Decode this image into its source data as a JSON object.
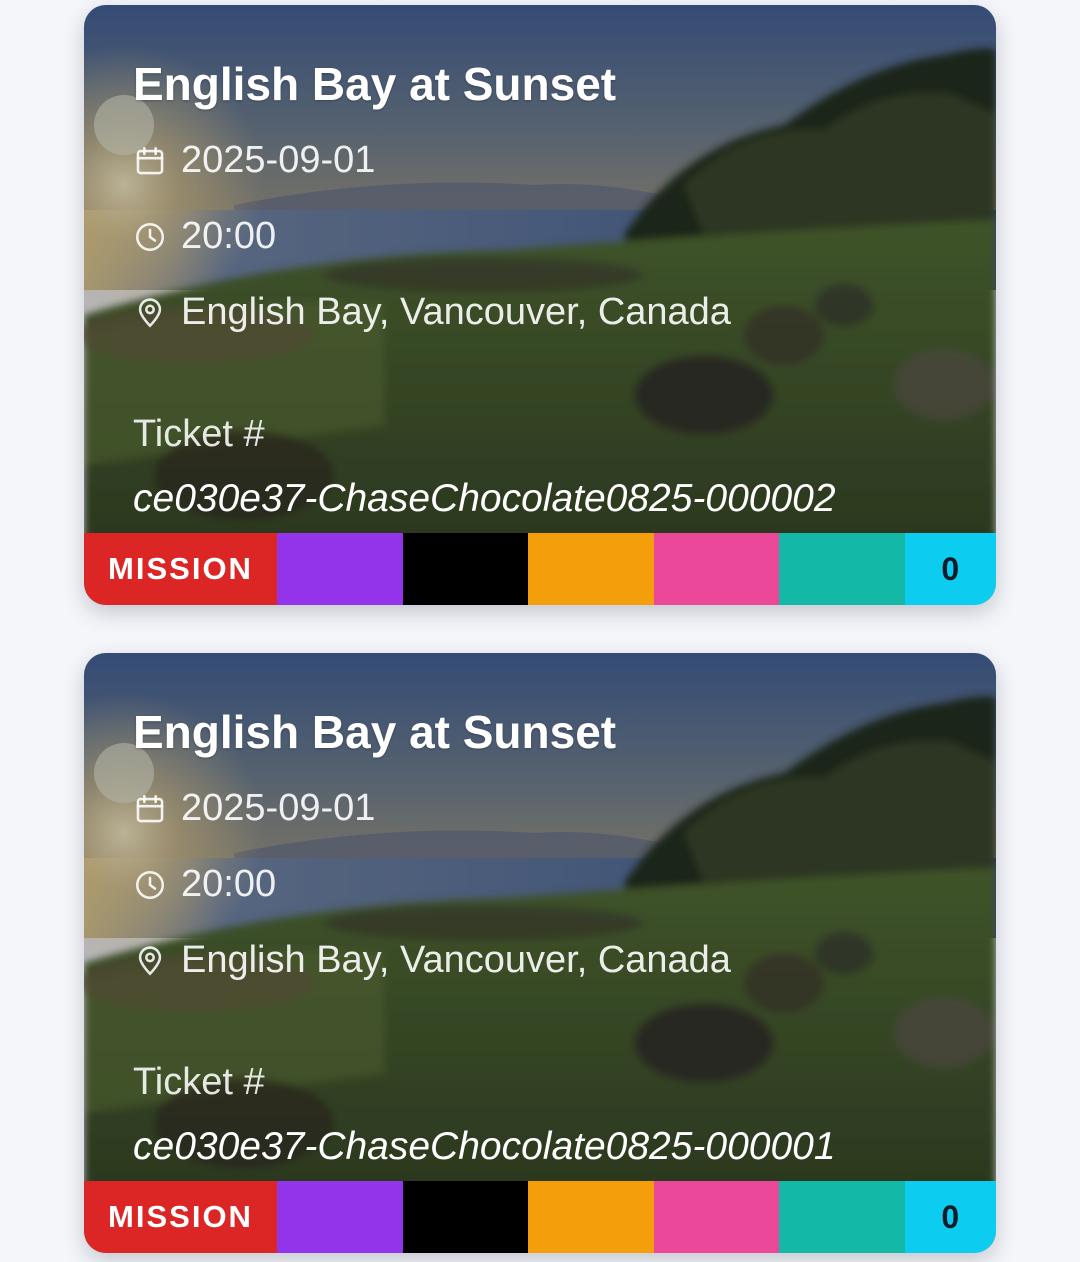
{
  "colors": {
    "mission": "#dc2626",
    "purple": "#9333ea",
    "black": "#000000",
    "orange": "#f59e0b",
    "pink": "#ec4899",
    "teal": "#14b8a6",
    "cyan": "#0ccdf0"
  },
  "icons": {
    "date": "calendar-icon",
    "time": "clock-icon",
    "place": "map-pin-icon"
  },
  "tickets": [
    {
      "title": "English Bay at Sunset",
      "date": "2025-09-01",
      "time": "20:00",
      "location": "English Bay, Vancouver, Canada",
      "ticket_label": "Ticket #",
      "ticket_number": "ce030e37-ChaseChocolate0825-000002",
      "badge": "MISSION",
      "count": "0"
    },
    {
      "title": "English Bay at Sunset",
      "date": "2025-09-01",
      "time": "20:00",
      "location": "English Bay, Vancouver, Canada",
      "ticket_label": "Ticket #",
      "ticket_number": "ce030e37-ChaseChocolate0825-000001",
      "badge": "MISSION",
      "count": "0"
    }
  ]
}
